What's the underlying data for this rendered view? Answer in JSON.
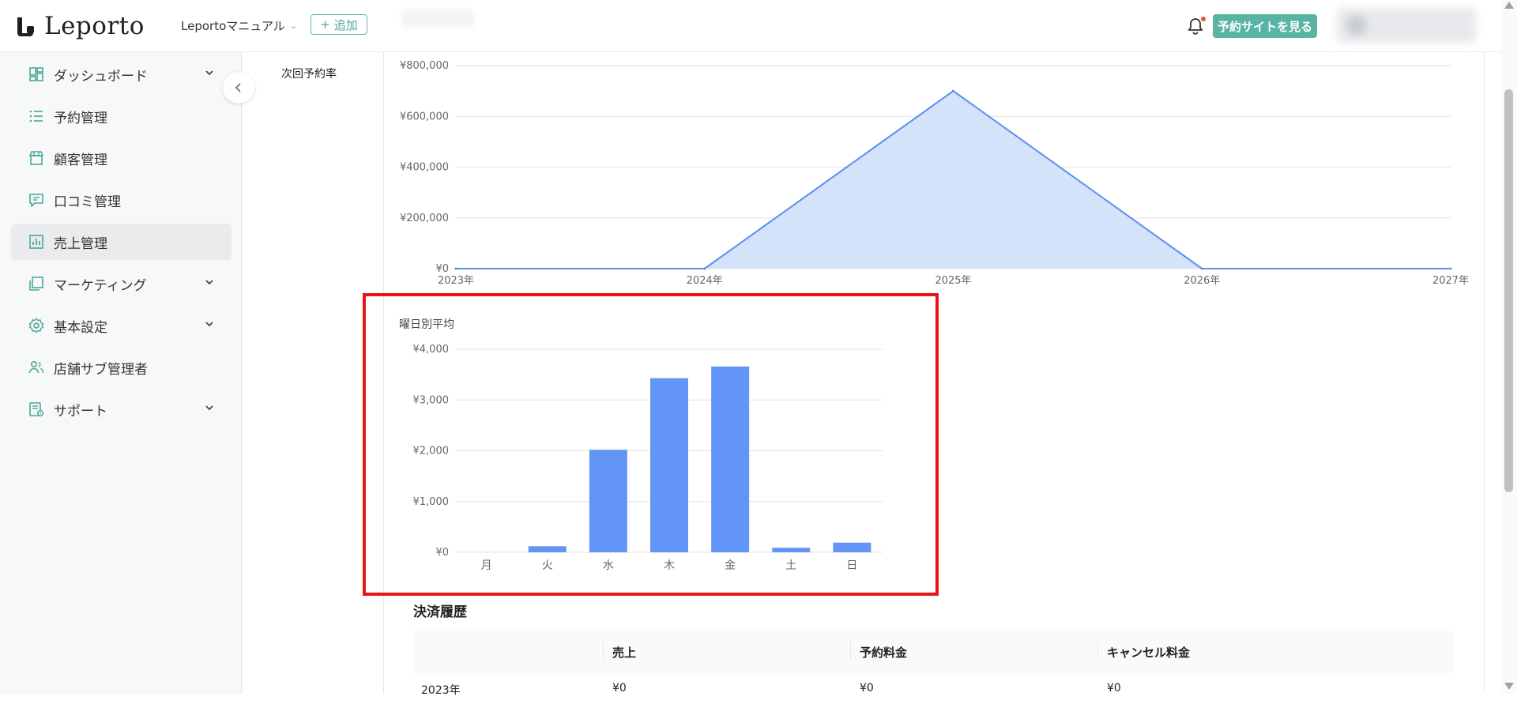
{
  "header": {
    "logo_text": "Leporto",
    "store_selector": "Leportoマニュアル",
    "add_button": "追加",
    "view_site_button": "予約サイトを見る"
  },
  "sidebar": {
    "items": [
      {
        "label": "ダッシュボード",
        "icon": "dashboard-icon",
        "has_chevron": true
      },
      {
        "label": "予約管理",
        "icon": "list-icon",
        "has_chevron": false
      },
      {
        "label": "顧客管理",
        "icon": "store-icon",
        "has_chevron": false
      },
      {
        "label": "口コミ管理",
        "icon": "chat-icon",
        "has_chevron": false
      },
      {
        "label": "売上管理",
        "icon": "bar-chart-icon",
        "has_chevron": false,
        "active": true
      },
      {
        "label": "マーケティング",
        "icon": "layers-icon",
        "has_chevron": true
      },
      {
        "label": "基本設定",
        "icon": "gear-icon",
        "has_chevron": true
      },
      {
        "label": "店舗サブ管理者",
        "icon": "users-icon",
        "has_chevron": false
      },
      {
        "label": "サポート",
        "icon": "support-icon",
        "has_chevron": true
      }
    ]
  },
  "main": {
    "left_label": "次回予約率"
  },
  "chart_data": [
    {
      "type": "area",
      "title": "",
      "x": [
        "2023年",
        "2024年",
        "2025年",
        "2026年",
        "2027年"
      ],
      "values": [
        0,
        0,
        700000,
        0,
        0
      ],
      "y_ticks": [
        "¥800,000",
        "¥600,000",
        "¥400,000",
        "¥200,000",
        "¥0"
      ],
      "ylim": [
        0,
        800000
      ],
      "grid": true,
      "colors": {
        "line": "#5b8ff0",
        "fill": "#d4e2fa"
      }
    },
    {
      "type": "bar",
      "title": "曜日別平均",
      "categories": [
        "月",
        "火",
        "水",
        "木",
        "金",
        "土",
        "日"
      ],
      "values": [
        0,
        120,
        2020,
        3430,
        3660,
        90,
        190
      ],
      "y_ticks": [
        "¥4,000",
        "¥3,000",
        "¥2,000",
        "¥1,000",
        "¥0"
      ],
      "ylim": [
        0,
        4000
      ],
      "grid": true,
      "colors": {
        "bar": "#6395f7"
      }
    }
  ],
  "payment_history": {
    "title": "決済履歴",
    "columns": [
      "",
      "売上",
      "予約料金",
      "キャンセル料金"
    ],
    "rows": [
      [
        "2023年",
        "¥0",
        "¥0",
        "¥0"
      ]
    ]
  },
  "colors": {
    "accent": "#5ab4a6",
    "highlight": "#e8141a"
  }
}
